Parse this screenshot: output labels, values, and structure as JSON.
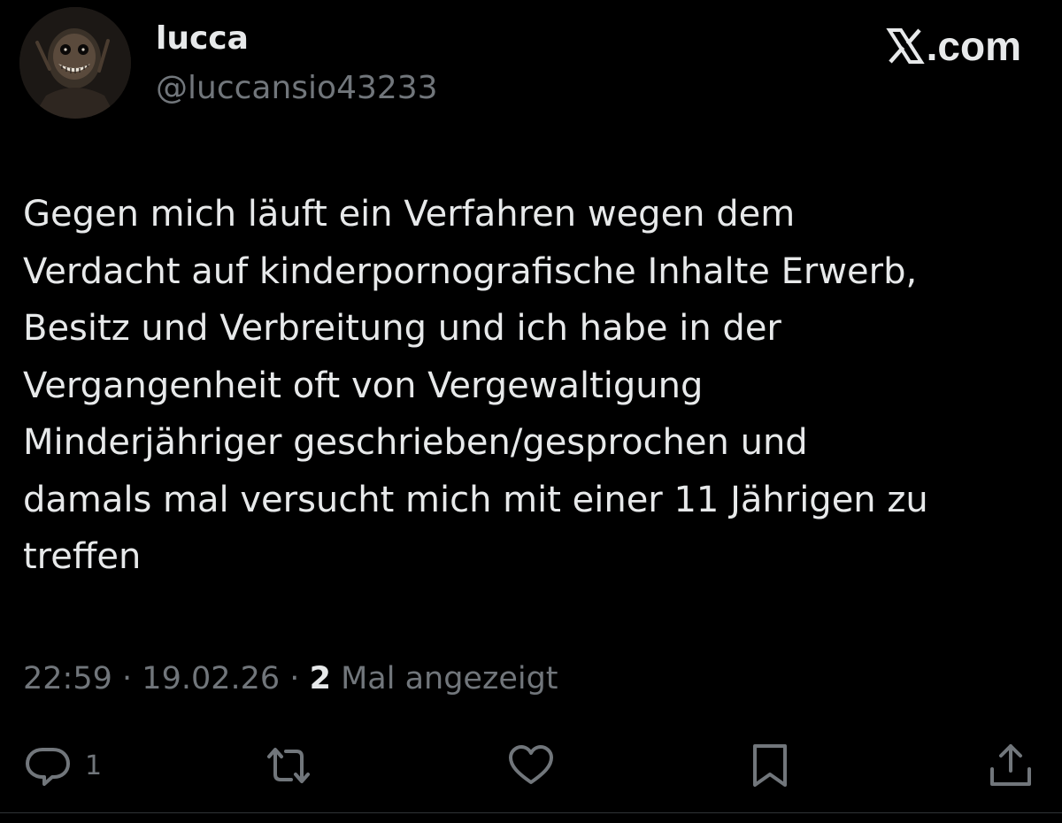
{
  "author": {
    "display_name": "lucca",
    "handle": "@luccansio43233"
  },
  "brand": {
    "text": ".com",
    "icon": "x-logo-icon"
  },
  "tweet": {
    "text": "Gegen mich läuft ein Verfahren wegen dem\nVerdacht auf kinderpornografische Inhalte Erwerb,\nBesitz und Verbreitung und ich habe in der\nVergangenheit oft von Vergewaltigung\nMinderjähriger geschrieben/gesprochen und\ndamals mal versucht mich mit einer 11 Jährigen zu\ntreffen"
  },
  "meta": {
    "time": "22:59",
    "separator": "·",
    "date": "19.02.26",
    "views_count": "2",
    "views_label": "Mal angezeigt"
  },
  "actions": {
    "reply": {
      "icon": "reply-icon",
      "count": "1"
    },
    "repost": {
      "icon": "repost-icon"
    },
    "like": {
      "icon": "heart-icon"
    },
    "bookmark": {
      "icon": "bookmark-icon"
    },
    "share": {
      "icon": "share-icon"
    }
  },
  "colors": {
    "background": "#000000",
    "primary_text": "#e7e9ea",
    "secondary_text": "#71767b",
    "divider": "#2f3336"
  }
}
